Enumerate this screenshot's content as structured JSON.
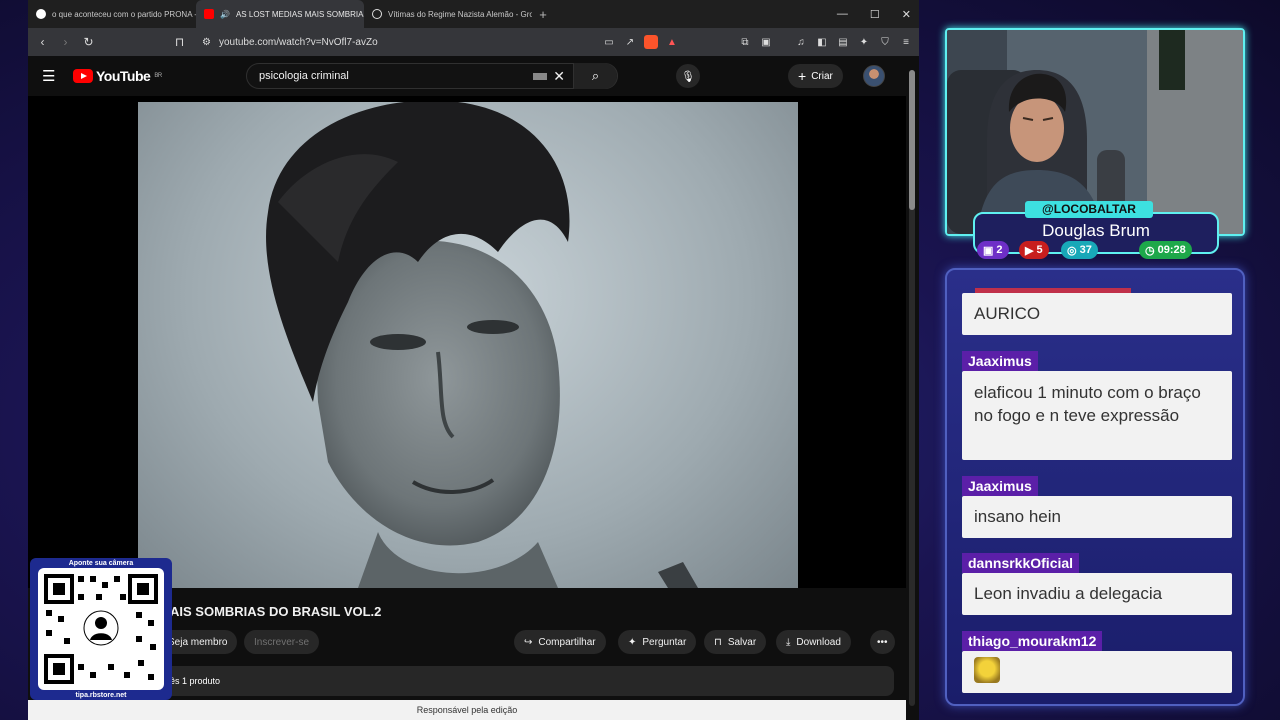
{
  "browser": {
    "tabs": [
      {
        "label": "o que aconteceu com o partido PRONA - Pe",
        "active": false
      },
      {
        "label": "AS LOST MEDIAS MAIS SOMBRIAS",
        "active": true
      },
      {
        "label": "Vítimas do Regime Nazista Alemão - Grok",
        "active": false
      }
    ],
    "url": "youtube.com/watch?v=NvOfl7-avZo"
  },
  "youtube": {
    "logo": "YouTube",
    "region": "BR",
    "search_value": "psicologia criminal",
    "create_label": "Criar",
    "video_title": "AIS SOMBRIAS DO BRASIL VOL.2",
    "member_label": "Seja membro",
    "subscribe_label": "Inscrever-se",
    "share_label": "Compartilhar",
    "ask_label": "Perguntar",
    "save_label": "Salvar",
    "download_label": "Download",
    "desc_text": "ês   1 produto",
    "bottom_text": "Responsável pela edição"
  },
  "qr": {
    "title": "Aponte sua câmera",
    "url": "tipa.rbstore.net"
  },
  "stream": {
    "handle": "@LOCOBALTAR",
    "name": "Douglas Brum",
    "stats": [
      "2",
      "5",
      "37",
      "09:28"
    ]
  },
  "chat": [
    {
      "user": "",
      "message": "AURICO"
    },
    {
      "user": "Jaaximus",
      "message": "elaficou 1 minuto com o braço no fogo e n teve expressão"
    },
    {
      "user": "Jaaximus",
      "message": "insano hein"
    },
    {
      "user": "dannsrkkOficial",
      "message": "Leon invadiu a delegacia"
    },
    {
      "user": "thiago_mourakm12",
      "message": ""
    }
  ],
  "colors": {
    "accent_cyan": "#5ff0f0",
    "chat_name_bg": "#5b1fa8",
    "youtube_red": "#ff0000"
  }
}
